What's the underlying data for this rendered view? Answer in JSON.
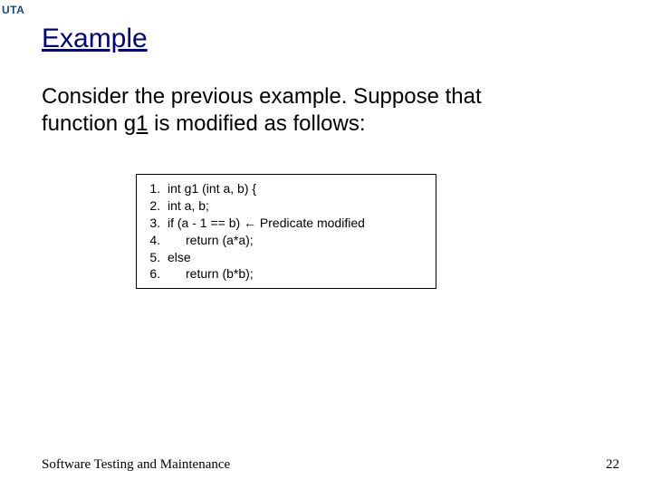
{
  "logo": "UTA",
  "title": "Example",
  "body": {
    "line1": "Consider the previous example. Suppose that ",
    "line2a": "function ",
    "func": "g1",
    "line2b": " is modified as follows:"
  },
  "code": {
    "l1": "int g1 (int a, b) {",
    "l2": "int a, b;",
    "l3_pre": "if (a - 1 == b) ",
    "l3_arrow": "←",
    "l3_post": " Predicate modified",
    "l4": "return (a*a);",
    "l5": "else",
    "l6": "return (b*b);"
  },
  "footer": {
    "left": "Software Testing and Maintenance",
    "page": "22"
  }
}
